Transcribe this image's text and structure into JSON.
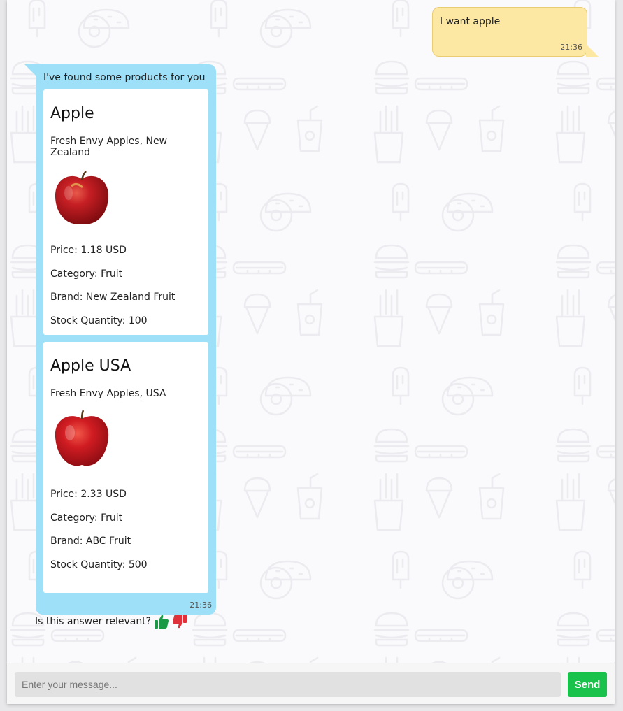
{
  "messages": {
    "user": {
      "text": "I want apple",
      "time": "21:36"
    },
    "bot": {
      "intro": "I've found some products for you",
      "time": "21:36",
      "products": [
        {
          "name": "Apple",
          "description": "Fresh Envy Apples, New Zealand",
          "price": "Price: 1.18 USD",
          "category": "Category: Fruit",
          "brand": "Brand: New Zealand Fruit",
          "stock": "Stock Quantity: 100"
        },
        {
          "name": "Apple USA",
          "description": "Fresh Envy Apples, USA",
          "price": "Price: 2.33 USD",
          "category": "Category: Fruit",
          "brand": "Brand: ABC Fruit",
          "stock": "Stock Quantity: 500"
        }
      ]
    }
  },
  "feedback": {
    "question": "Is this answer relevant?"
  },
  "composer": {
    "placeholder": "Enter your message...",
    "send_label": "Send"
  },
  "colors": {
    "user_bubble": "#fde8a3",
    "bot_bubble": "#9ee0f8",
    "send_button": "#19c24a",
    "thumb_up": "#1a9a44",
    "thumb_down": "#e0303a"
  }
}
